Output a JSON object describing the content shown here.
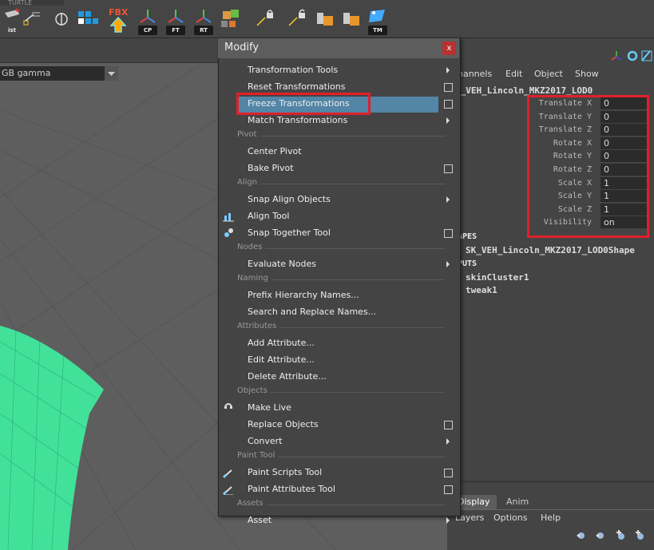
{
  "shelf": {
    "tab_label": "TURTLE",
    "buttons": [
      {
        "icon": "list-icon",
        "badge": "ist"
      },
      {
        "icon": "settings-icon"
      },
      {
        "icon": "pivot-icon"
      },
      {
        "icon": "grid-icon"
      },
      {
        "icon": "fbx-export-icon",
        "badge": "FBX"
      },
      {
        "icon": "center-pivot-icon",
        "badge": "CP"
      },
      {
        "icon": "freeze-transform-icon",
        "badge": "FT"
      },
      {
        "icon": "reset-transform-icon",
        "badge": "RT"
      },
      {
        "icon": "texture-icon"
      },
      {
        "icon": "lock-icon"
      },
      {
        "icon": "unlock-icon"
      },
      {
        "icon": "bucket-icon"
      },
      {
        "icon": "bucket2-icon"
      },
      {
        "icon": "tm-icon",
        "badge": "TM"
      }
    ]
  },
  "viewport": {
    "gamma": "GB gamma"
  },
  "menu": {
    "title": "Modify",
    "close": "x",
    "items": [
      {
        "type": "item",
        "label": "Transformation Tools",
        "arrow": true
      },
      {
        "type": "item",
        "label": "Reset Transformations",
        "box": true
      },
      {
        "type": "item",
        "label": "Freeze Transformations",
        "box": true,
        "highlight": true
      },
      {
        "type": "item",
        "label": "Match Transformations",
        "arrow": true
      },
      {
        "type": "section",
        "label": "Pivot"
      },
      {
        "type": "item",
        "label": "Center Pivot"
      },
      {
        "type": "item",
        "label": "Bake Pivot",
        "box": true
      },
      {
        "type": "section",
        "label": "Align"
      },
      {
        "type": "item",
        "label": "Snap Align Objects",
        "arrow": true
      },
      {
        "type": "item",
        "label": "Align Tool",
        "icon": "align-tool-icon"
      },
      {
        "type": "item",
        "label": "Snap Together Tool",
        "box": true,
        "icon": "snap-together-icon"
      },
      {
        "type": "section",
        "label": "Nodes"
      },
      {
        "type": "item",
        "label": "Evaluate Nodes",
        "arrow": true
      },
      {
        "type": "section",
        "label": "Naming"
      },
      {
        "type": "item",
        "label": "Prefix Hierarchy Names..."
      },
      {
        "type": "item",
        "label": "Search and Replace Names..."
      },
      {
        "type": "section",
        "label": "Attributes"
      },
      {
        "type": "item",
        "label": "Add Attribute..."
      },
      {
        "type": "item",
        "label": "Edit Attribute..."
      },
      {
        "type": "item",
        "label": "Delete Attribute..."
      },
      {
        "type": "section",
        "label": "Objects"
      },
      {
        "type": "item",
        "label": "Make Live",
        "icon": "magnet-icon"
      },
      {
        "type": "item",
        "label": "Replace Objects",
        "box": true
      },
      {
        "type": "item",
        "label": "Convert",
        "arrow": true
      },
      {
        "type": "section",
        "label": "Paint Tool"
      },
      {
        "type": "item",
        "label": "Paint Scripts Tool",
        "box": true,
        "icon": "paint-brush-icon"
      },
      {
        "type": "item",
        "label": "Paint Attributes Tool",
        "box": true,
        "icon": "paint-attr-icon"
      },
      {
        "type": "section",
        "label": "Assets"
      },
      {
        "type": "item",
        "label": "Asset",
        "arrow": true
      }
    ]
  },
  "channel_box": {
    "menu": [
      "hannels",
      "Edit",
      "Object",
      "Show"
    ],
    "object_name": "K_VEH_Lincoln_MKZ2017_LOD0",
    "attributes": [
      {
        "label": "Translate X",
        "value": "0"
      },
      {
        "label": "Translate Y",
        "value": "0"
      },
      {
        "label": "Translate Z",
        "value": "0"
      },
      {
        "label": "Rotate X",
        "value": "0"
      },
      {
        "label": "Rotate Y",
        "value": "0"
      },
      {
        "label": "Rotate Z",
        "value": "0"
      },
      {
        "label": "Scale X",
        "value": "1"
      },
      {
        "label": "Scale Y",
        "value": "1"
      },
      {
        "label": "Scale Z",
        "value": "1"
      },
      {
        "label": "Visibility",
        "value": "on"
      }
    ],
    "shapes_header": "APES",
    "shape_name": "SK_VEH_Lincoln_MKZ2017_LOD0Shape",
    "inputs_header": "PUTS",
    "inputs": [
      "skinCluster1",
      "tweak1"
    ]
  },
  "layer_editor": {
    "tabs": [
      "Display",
      "Anim"
    ],
    "menu": [
      "Layers",
      "Options",
      "Help"
    ]
  },
  "colors": {
    "highlight": "#5285a6",
    "annotation": "#e0202a",
    "mesh": "#3ef0a0"
  }
}
